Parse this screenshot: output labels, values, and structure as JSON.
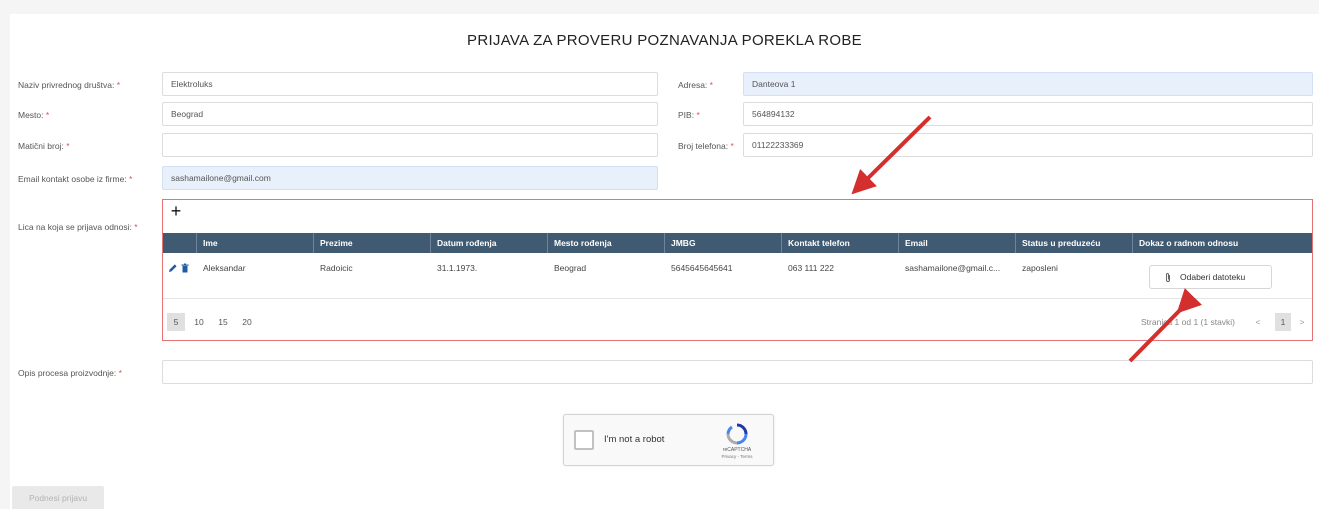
{
  "title": "PRIJAVA ZA PROVERU POZNAVANJA POREKLA ROBE",
  "required_marker": "*",
  "fields": {
    "naziv": {
      "label": "Naziv privrednog društva:",
      "value": "Elektroluks"
    },
    "adresa": {
      "label": "Adresa:",
      "value": "Danteova 1"
    },
    "mesto": {
      "label": "Mesto:",
      "value": "Beograd"
    },
    "pib": {
      "label": "PIB:",
      "value": "564894132"
    },
    "maticni": {
      "label": "Matični broj:",
      "value": ""
    },
    "telefon": {
      "label": "Broj telefona:",
      "value": "01122233369"
    },
    "email": {
      "label": "Email kontakt osobe iz firme:",
      "value": "sashamailone@gmail.com"
    },
    "lica_label": "Lica na koja se prijava odnosi:",
    "opis": {
      "label": "Opis procesa proizvodnje:",
      "value": ""
    }
  },
  "table": {
    "add_label": "+",
    "headers": [
      "Ime",
      "Prezime",
      "Datum rođenja",
      "Mesto rođenja",
      "JMBG",
      "Kontakt telefon",
      "Email",
      "Status u preduzeću",
      "Dokaz o radnom odnosu"
    ],
    "rows": [
      {
        "ime": "Aleksandar",
        "prezime": "Radoicic",
        "datum": "31.1.1973.",
        "mesto": "Beograd",
        "jmbg": "5645645645641",
        "telefon": "063 111 222",
        "email": "sashamailone@gmail.c...",
        "status": "zaposleni",
        "file_button": "Odaberi datoteku"
      }
    ],
    "page_sizes": [
      "5",
      "10",
      "15",
      "20"
    ],
    "active_page_size": "5",
    "page_info": "Stranica 1 od 1 (1 stavki)",
    "current_page": "1",
    "prev": "<",
    "next": ">"
  },
  "captcha": {
    "text": "I'm not a robot",
    "brand": "reCAPTCHA",
    "links": "Privacy - Terms"
  },
  "submit_label": "Podnesi prijavu",
  "colors": {
    "table_header": "#405a72",
    "panel_border": "#e57373",
    "highlight_input": "#e8f0fb",
    "annotation_arrow": "#d32f2f"
  }
}
